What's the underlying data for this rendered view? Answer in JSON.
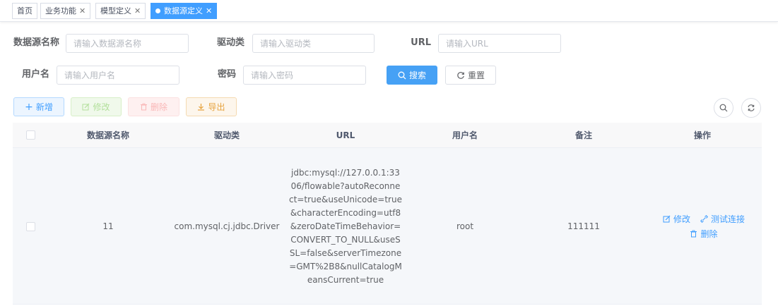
{
  "tags": [
    {
      "label": "首页"
    },
    {
      "label": "业务功能"
    },
    {
      "label": "模型定义"
    },
    {
      "label": "数据源定义"
    }
  ],
  "search": {
    "name_label": "数据源名称",
    "name_placeholder": "请输入数据源名称",
    "driver_label": "驱动类",
    "driver_placeholder": "请输入驱动类",
    "url_label": "URL",
    "url_placeholder": "请输入URL",
    "user_label": "用户名",
    "user_placeholder": "请输入用户名",
    "password_label": "密码",
    "password_placeholder": "请输入密码",
    "search_button": "搜索",
    "reset_button": "重置"
  },
  "toolbar": {
    "add": "新增",
    "edit": "修改",
    "delete": "删除",
    "export": "导出"
  },
  "table": {
    "columns": [
      "数据源名称",
      "驱动类",
      "URL",
      "用户名",
      "备注",
      "操作"
    ],
    "rows": [
      {
        "name": "11",
        "driver": "com.mysql.cj.jdbc.Driver",
        "url": "jdbc:mysql://127.0.0.1:3306/flowable?autoReconnect=true&useUnicode=true&characterEncoding=utf8&zeroDateTimeBehavior=CONVERT_TO_NULL&useSSL=false&serverTimezone=GMT%2B8&nullCatalogMeansCurrent=true",
        "user": "root",
        "remark": "111111",
        "op_edit": "修改",
        "op_test": "测试连接",
        "op_delete": "删除"
      }
    ]
  },
  "colors": {
    "primary": "#409eff",
    "success": "#67c23a",
    "danger": "#f56c6c",
    "warning": "#e6a23c"
  }
}
